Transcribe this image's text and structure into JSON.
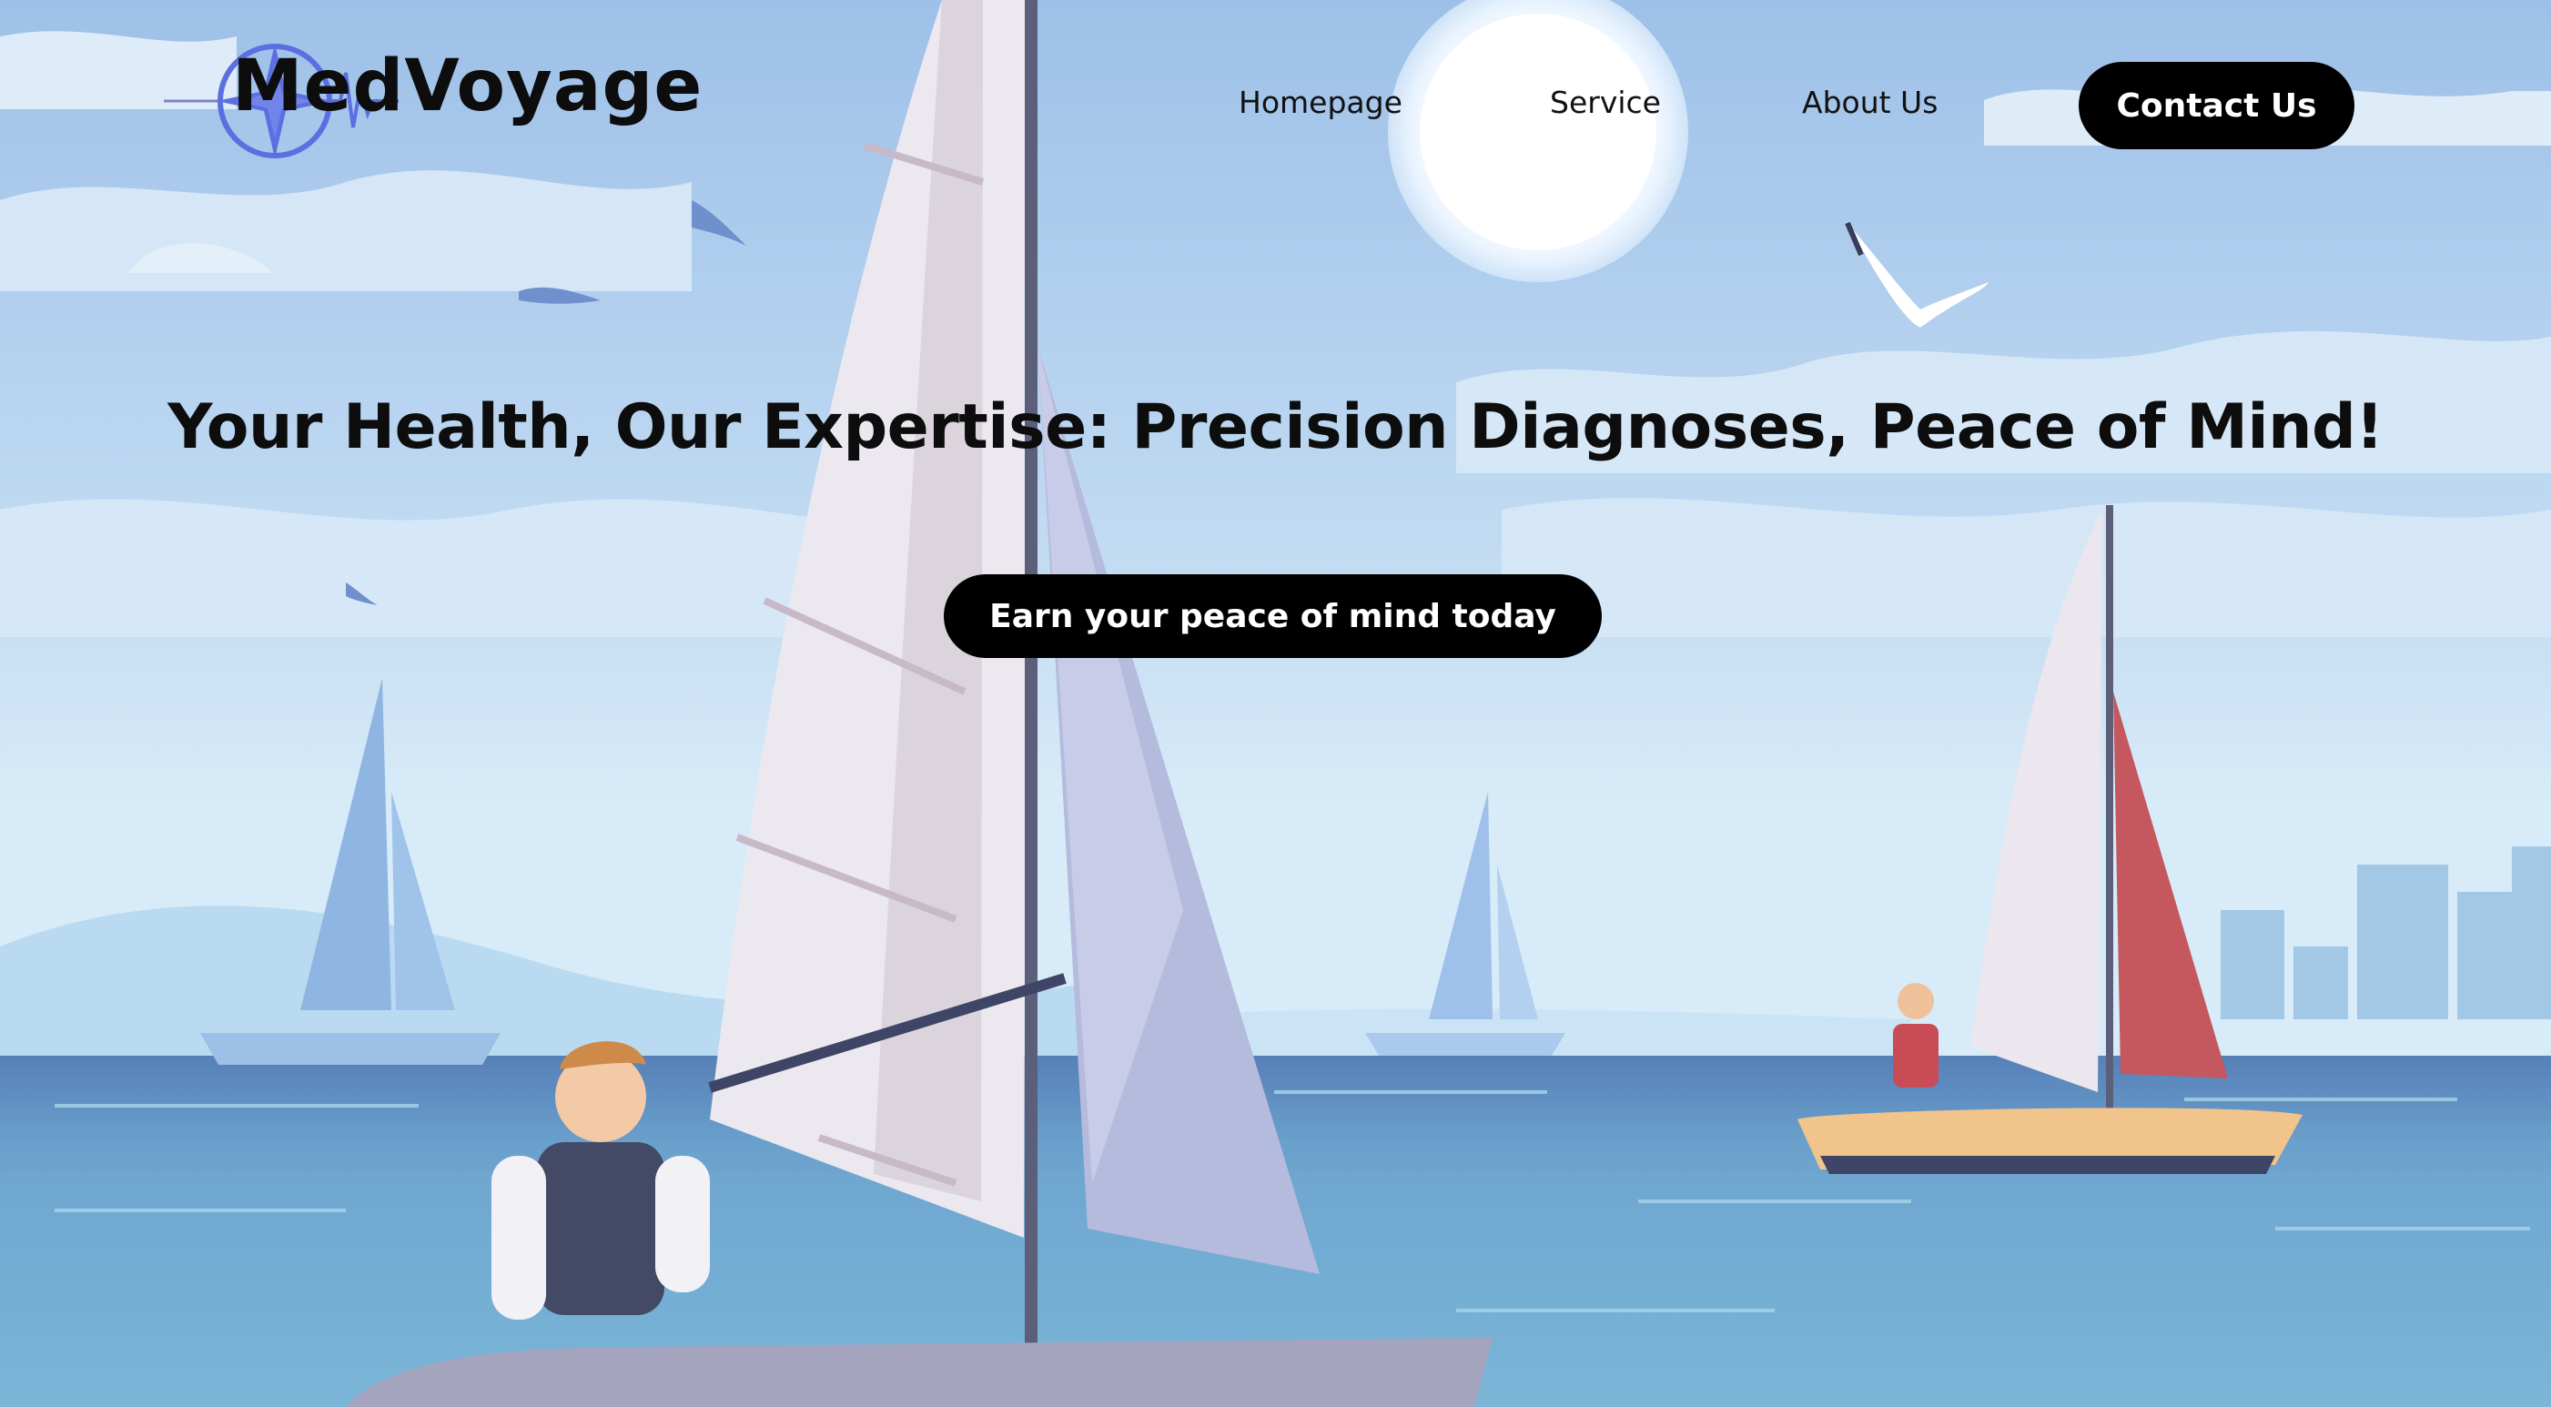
{
  "header": {
    "brand_name": "MedVoyage",
    "logo_icon": "compass-heartbeat-icon",
    "nav": [
      {
        "label": "Homepage"
      },
      {
        "label": "Service"
      },
      {
        "label": "About Us"
      }
    ],
    "contact_label": "Contact Us"
  },
  "hero": {
    "headline": "Your Health, Our Expertise: Precision Diagnoses, Peace of Mind!",
    "cta_label": "Earn your peace of mind today"
  },
  "colors": {
    "brand_accent": "#5b6fe0",
    "button_bg": "#000000",
    "button_text": "#ffffff",
    "sky": "#a9c9ea",
    "sea": "#5b86bb"
  }
}
